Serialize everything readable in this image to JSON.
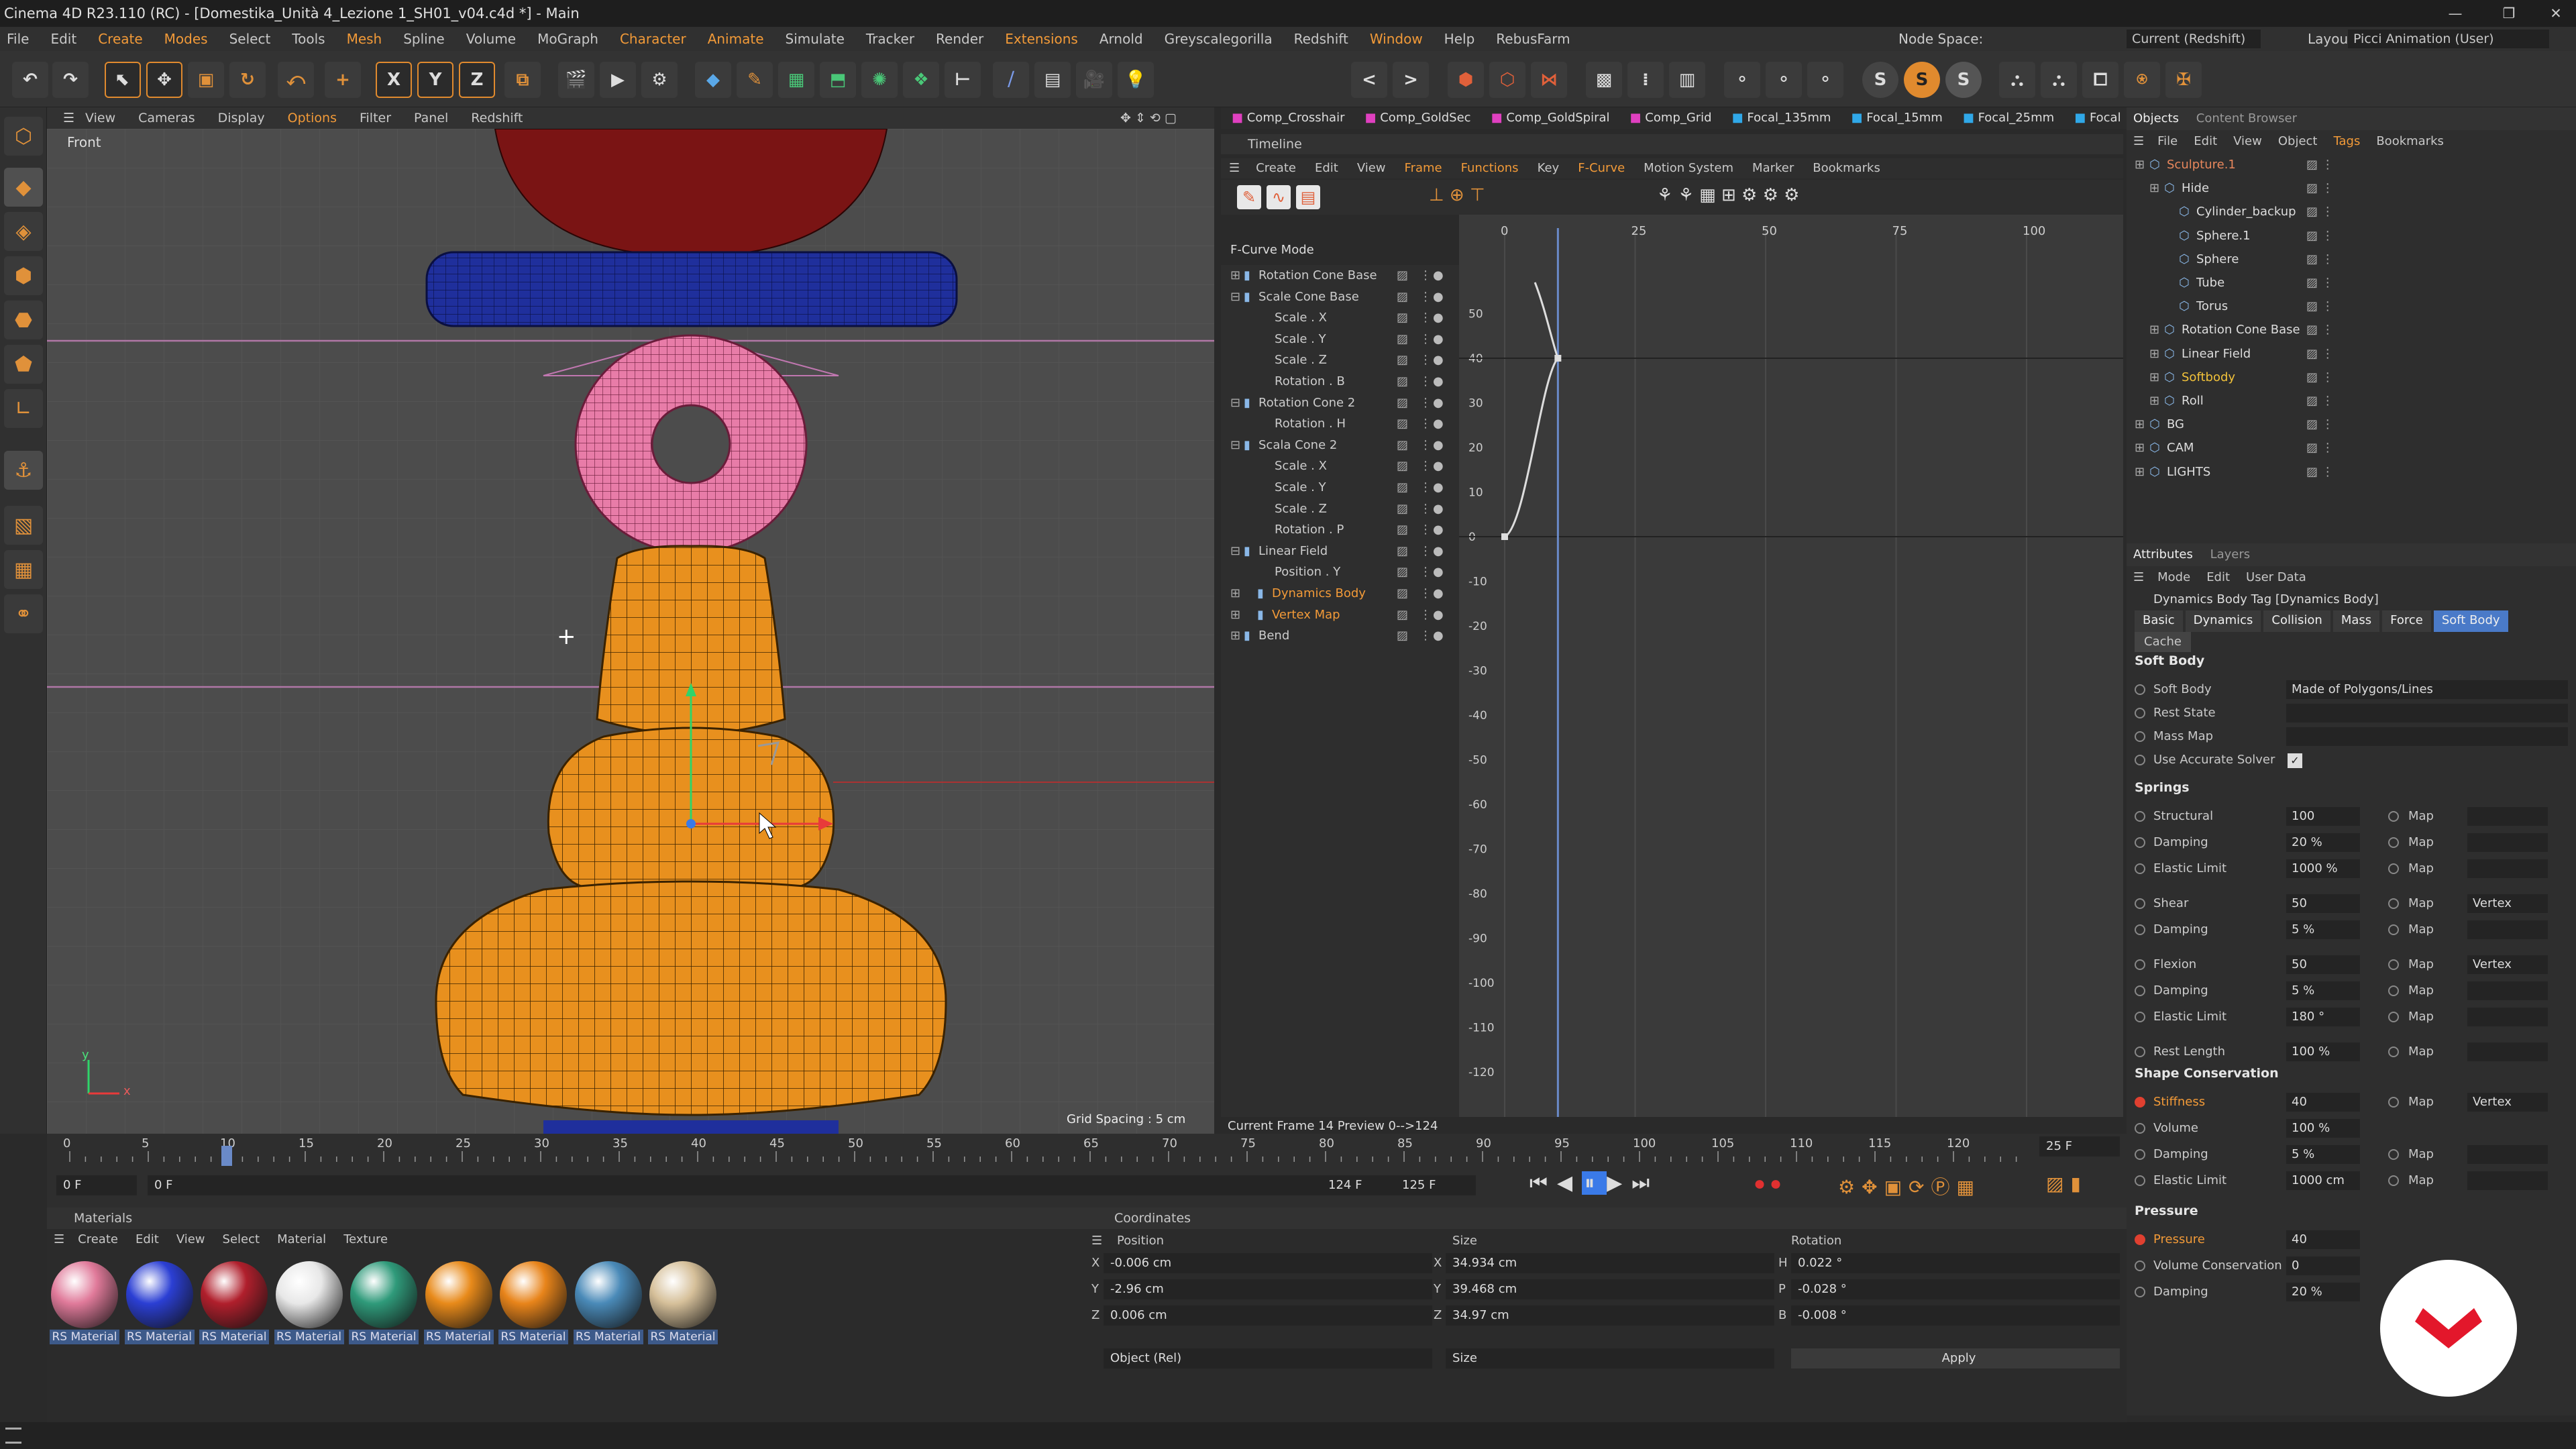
{
  "window": {
    "title": "Cinema 4D R23.110 (RC) - [Domestika_Unità 4_Lezione 1_SH01_v04.c4d *] - Main",
    "min": "—",
    "max": "❐",
    "close": "✕"
  },
  "menu": [
    "File",
    "Edit",
    "Create",
    "Modes",
    "Select",
    "Tools",
    "Mesh",
    "Spline",
    "Volume",
    "MoGraph",
    "Character",
    "Animate",
    "Simulate",
    "Tracker",
    "Render",
    "Extensions",
    "Arnold",
    "Greyscalegorilla",
    "Redshift",
    "Window",
    "Help",
    "RebusFarm"
  ],
  "nodespace": {
    "label": "Node Space:",
    "value": "Current (Redshift)"
  },
  "layout": {
    "label": "Layout:",
    "value": "Picci Animation (User)"
  },
  "toolbar": {
    "x": "X",
    "y": "Y",
    "z": "Z",
    "s1": "S",
    "s2": "S",
    "s3": "S"
  },
  "viewport": {
    "menu": [
      "View",
      "Cameras",
      "Display",
      "Options",
      "Filter",
      "Panel",
      "Redshift"
    ],
    "name": "Front",
    "grid": "Grid Spacing : 5 cm",
    "axis_x": "x",
    "axis_y": "y"
  },
  "takes": [
    "Comp_Crosshair",
    "Comp_GoldSec",
    "Comp_GoldSpiral",
    "Comp_Grid",
    "Focal_135mm",
    "Focal_15mm",
    "Focal_25mm",
    "Focal"
  ],
  "timeline": {
    "title": "Timeline",
    "menu": [
      "Create",
      "Edit",
      "View",
      "Frame",
      "Functions",
      "Key",
      "F-Curve",
      "Motion System",
      "Marker",
      "Bookmarks"
    ],
    "mode": "F-Curve Mode",
    "frame_ticks": [
      "0",
      "25",
      "50",
      "75",
      "100"
    ],
    "y_ticks": [
      "50",
      "40",
      "30",
      "20",
      "10",
      "0",
      "-10",
      "-20",
      "-30",
      "-40",
      "-50",
      "-60",
      "-70",
      "-80",
      "-90",
      "-100",
      "-110",
      "-120"
    ],
    "current": "Current Frame  14  Preview  0-->124",
    "tracks": [
      {
        "label": "Rotation Cone Base",
        "indent": 0,
        "exp": "⊞"
      },
      {
        "label": "Scale Cone Base",
        "indent": 0,
        "exp": "⊟"
      },
      {
        "label": "Scale . X",
        "indent": 2,
        "exp": ""
      },
      {
        "label": "Scale . Y",
        "indent": 2,
        "exp": ""
      },
      {
        "label": "Scale . Z",
        "indent": 2,
        "exp": ""
      },
      {
        "label": "Rotation . B",
        "indent": 2,
        "exp": ""
      },
      {
        "label": "Rotation Cone 2",
        "indent": 0,
        "exp": "⊟"
      },
      {
        "label": "Rotation . H",
        "indent": 2,
        "exp": ""
      },
      {
        "label": "Scala Cone 2",
        "indent": 0,
        "exp": "⊟"
      },
      {
        "label": "Scale . X",
        "indent": 2,
        "exp": ""
      },
      {
        "label": "Scale . Y",
        "indent": 2,
        "exp": ""
      },
      {
        "label": "Scale . Z",
        "indent": 2,
        "exp": ""
      },
      {
        "label": "Rotation . P",
        "indent": 2,
        "exp": ""
      },
      {
        "label": "Linear Field",
        "indent": 0,
        "exp": "⊟"
      },
      {
        "label": "Position . Y",
        "indent": 2,
        "exp": ""
      },
      {
        "label": "Dynamics Body",
        "indent": 1,
        "exp": "⊞",
        "orange": true
      },
      {
        "label": "Vertex Map",
        "indent": 1,
        "exp": "⊞",
        "orange": true
      },
      {
        "label": "Bend",
        "indent": 0,
        "exp": "⊞"
      }
    ]
  },
  "objects": {
    "tabs": [
      "Objects",
      "Content Browser"
    ],
    "menu": [
      "File",
      "Edit",
      "View",
      "Object",
      "Tags",
      "Bookmarks"
    ],
    "rows": [
      {
        "name": "Sculpture.1",
        "indent": 0,
        "color": "#e8875c"
      },
      {
        "name": "Hide",
        "indent": 1,
        "color": "#dddddd"
      },
      {
        "name": "Cylinder_backup",
        "indent": 2,
        "color": "#dddddd"
      },
      {
        "name": "Sphere.1",
        "indent": 2,
        "color": "#dddddd"
      },
      {
        "name": "Sphere",
        "indent": 2,
        "color": "#dddddd"
      },
      {
        "name": "Tube",
        "indent": 2,
        "color": "#dddddd"
      },
      {
        "name": "Torus",
        "indent": 2,
        "color": "#dddddd"
      },
      {
        "name": "Rotation Cone Base",
        "indent": 1,
        "color": "#dddddd"
      },
      {
        "name": "Linear Field",
        "indent": 1,
        "color": "#dddddd"
      },
      {
        "name": "Softbody",
        "indent": 1,
        "color": "#f2c23a"
      },
      {
        "name": "Roll",
        "indent": 1,
        "color": "#dddddd"
      },
      {
        "name": "BG",
        "indent": 0,
        "color": "#dddddd"
      },
      {
        "name": "CAM",
        "indent": 0,
        "color": "#dddddd"
      },
      {
        "name": "LIGHTS",
        "indent": 0,
        "color": "#dddddd"
      }
    ]
  },
  "attributes": {
    "tabs": [
      "Attributes",
      "Layers"
    ],
    "menu": [
      "Mode",
      "Edit",
      "User Data"
    ],
    "tag": "Dynamics Body Tag [Dynamics Body]",
    "subtabs": [
      "Basic",
      "Dynamics",
      "Collision",
      "Mass",
      "Force",
      "Soft Body"
    ],
    "cache": "Cache",
    "softbody": {
      "title": "Soft Body",
      "soft_body_label": "Soft Body",
      "soft_body_value": "Made of Polygons/Lines",
      "rest_state": "Rest State",
      "mass_map": "Mass Map",
      "accurate": "Use Accurate Solver"
    },
    "springs_title": "Springs",
    "springs": [
      {
        "label": "Structural",
        "value": "100",
        "map": "Map"
      },
      {
        "label": "Damping",
        "value": "20 %",
        "map": "Map"
      },
      {
        "label": "Elastic Limit",
        "value": "1000 %",
        "map": "Map"
      },
      {
        "label": "Shear",
        "value": "50",
        "map": "Map",
        "vertex": "Vertex"
      },
      {
        "label": "Damping",
        "value": "5 %",
        "map": "Map"
      },
      {
        "label": "Flexion",
        "value": "50",
        "map": "Map",
        "vertex": "Vertex"
      },
      {
        "label": "Damping",
        "value": "5 %",
        "map": "Map"
      },
      {
        "label": "Elastic Limit",
        "value": "180 °",
        "map": "Map"
      },
      {
        "label": "Rest Length",
        "value": "100 %",
        "map": "Map"
      }
    ],
    "shape_title": "Shape Conservation",
    "shape": [
      {
        "label": "Stiffness",
        "value": "40",
        "map": "Map",
        "vertex": "Vertex",
        "orange": true
      },
      {
        "label": "Volume",
        "value": "100 %",
        "map": ""
      },
      {
        "label": "Damping",
        "value": "5 %",
        "map": "Map"
      },
      {
        "label": "Elastic Limit",
        "value": "1000 cm",
        "map": "Map"
      }
    ],
    "pressure_title": "Pressure",
    "pressure": [
      {
        "label": "Pressure",
        "value": "40",
        "orange": true
      },
      {
        "label": "Volume Conservation",
        "value": "0"
      },
      {
        "label": "Damping",
        "value": "20 %"
      }
    ]
  },
  "transport": {
    "ruler": [
      "0",
      "5",
      "10",
      "15",
      "20",
      "25",
      "30",
      "35",
      "40",
      "45",
      "50",
      "55",
      "60",
      "65",
      "70",
      "75",
      "80",
      "85",
      "90",
      "95",
      "100",
      "105",
      "110",
      "115",
      "120"
    ],
    "start": "0 F",
    "cur": "0 F",
    "end": "124 F",
    "end2": "125 F",
    "fps": "25 F"
  },
  "materials": {
    "title": "Materials",
    "menu": [
      "Create",
      "Edit",
      "View",
      "Select",
      "Material",
      "Texture"
    ],
    "items": [
      {
        "label": "RS Material",
        "color": "#e07a9a"
      },
      {
        "label": "RS Material",
        "color": "#2b3fd4"
      },
      {
        "label": "RS Material",
        "color": "#b01f2c"
      },
      {
        "label": "RS Material",
        "color": "#e8e8e8"
      },
      {
        "label": "RS Material",
        "color": "#2f9a7a"
      },
      {
        "label": "RS Material",
        "color": "#e88a1a"
      },
      {
        "label": "RS Material",
        "color": "#e8841a"
      },
      {
        "label": "RS Material",
        "color": "#4a8ab8"
      },
      {
        "label": "RS Material",
        "color": "#d6c09a"
      }
    ]
  },
  "coordinates": {
    "title": "Coordinates",
    "hdr": [
      "Position",
      "Size",
      "Rotation"
    ],
    "rows": [
      {
        "a": "X",
        "pos": "-0.006 cm",
        "b": "X",
        "size": "34.934 cm",
        "c": "H",
        "rot": "0.022 °"
      },
      {
        "a": "Y",
        "pos": "-2.96 cm",
        "b": "Y",
        "size": "39.468 cm",
        "c": "P",
        "rot": "-0.028 °"
      },
      {
        "a": "Z",
        "pos": "0.006 cm",
        "b": "Z",
        "size": "34.97 cm",
        "c": "B",
        "rot": "-0.008 °"
      }
    ],
    "mode": "Object (Rel)",
    "sizemode": "Size",
    "apply": "Apply"
  },
  "colors": {
    "accent": "#e08a2e",
    "torus": "#e87ca8",
    "cone": "#e8901e",
    "tube": "#1f2f9c",
    "sphere": "#7a1414",
    "curve": "#dddddd"
  }
}
